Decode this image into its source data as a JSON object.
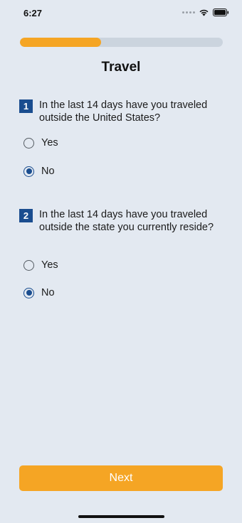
{
  "status_bar": {
    "time": "6:27",
    "icons": [
      "signal-dots-icon",
      "wifi-icon",
      "battery-icon"
    ]
  },
  "progress": {
    "value": 0.4,
    "fill_color": "#f5a524",
    "track_color": "#cbd4de"
  },
  "page": {
    "title": "Travel"
  },
  "questions": [
    {
      "number": "1",
      "text": "In the last 14 days have you traveled outside the United States?",
      "options": [
        {
          "label": "Yes",
          "selected": false
        },
        {
          "label": "No",
          "selected": true
        }
      ]
    },
    {
      "number": "2",
      "text": "In the last 14 days have you traveled outside the state you currently reside?",
      "options": [
        {
          "label": "Yes",
          "selected": false
        },
        {
          "label": "No",
          "selected": true
        }
      ]
    }
  ],
  "next_button": {
    "label": "Next"
  },
  "colors": {
    "background": "#e3e9f1",
    "accent": "#f5a524",
    "question_number": "#1a4d8f",
    "radio_selected": "#1a4d8f"
  }
}
